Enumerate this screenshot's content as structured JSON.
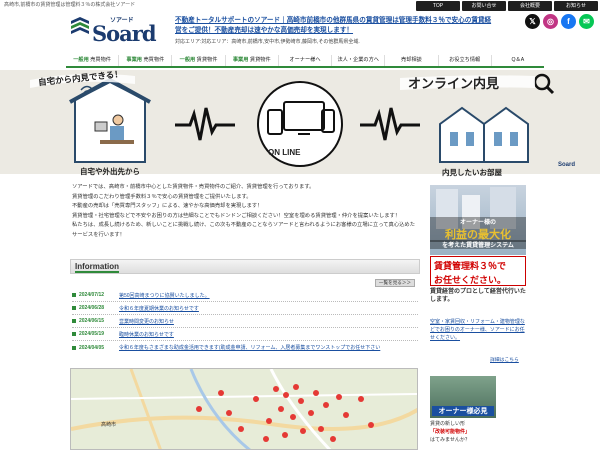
{
  "header": {
    "tagline": "高崎市,前橋市の賃貸管理は管理料３％の株式会社ソアード",
    "top_nav": [
      "TOP",
      "お問い合せ",
      "会社概要",
      "お知らせ"
    ],
    "logo_kana": "ソアード",
    "logo_name": "Soard",
    "headline": "不動産トータルサポートのソアード｜高崎市前橋市の他群馬県の賃貸管理は管理手数料３％で安心の賃貸経営をご提供！不動産売却は速やかな高価売却を実現します！",
    "area_text": "対応エリア:対応エリア：高崎市,前橋市,安中市,伊勢崎市,藤岡市,その他群馬県全域.",
    "social": [
      {
        "name": "x-icon",
        "glyph": "𝕏",
        "color": "#111111"
      },
      {
        "name": "instagram-icon",
        "glyph": "◎",
        "color": "#c13584"
      },
      {
        "name": "facebook-icon",
        "glyph": "f",
        "color": "#1877f2"
      },
      {
        "name": "line-icon",
        "glyph": "✉",
        "color": "#06c755"
      }
    ]
  },
  "main_nav": [
    {
      "prefix": "一般用",
      "label": "売買物件"
    },
    {
      "prefix": "事業用",
      "label": "売買物件"
    },
    {
      "prefix": "一般用",
      "label": "賃貸物件"
    },
    {
      "prefix": "事業用",
      "label": "賃貸物件"
    },
    {
      "prefix": "",
      "label": "オーナー様へ"
    },
    {
      "prefix": "",
      "label": "法人・企業の方へ"
    },
    {
      "prefix": "",
      "label": "売却相談"
    },
    {
      "prefix": "",
      "label": "お役立ち情報"
    },
    {
      "prefix": "",
      "label": "Q＆A"
    }
  ],
  "hero": {
    "left_banner": "自宅から内見できる！",
    "right_banner": "オンライン内見",
    "left_caption": "自宅や外出先から",
    "right_caption": "内見したいお部屋",
    "center_label": "ON LINE",
    "mini_logo": "Soard"
  },
  "intro": [
    "ソアードでは、高崎市・前橋市中心とした賃貸物件・売買物件のご紹介、賃貸管理を行っております。",
    "賃貸管理のこだわり管理手数料３％で安心の賃貸管理をご提供いたします。",
    "不動産の売却は「売買専門スタッフ」による、速やかな高価売却を実現します！",
    "賃貸管理・社宅管理などで不安やお困りの方は些細なことでもドンドンご相談ください！空室を埋める賃貸管理・仲介を提案いたします！",
    "私たちは、成長し続けるため、新しいことに挑戦し続け、この次も不動産のことならソアードと言われるようにお客様の立場に立って真心込めたサービスを行います！"
  ],
  "information": {
    "title": "Information",
    "more": "一覧を見る＞＞",
    "items": [
      {
        "date": "2024/07/12",
        "title": "第50回高崎まつりに協賛いたしました。"
      },
      {
        "date": "2024/06/28",
        "title": "令和６年度夏期休業のお知らせです"
      },
      {
        "date": "2024/06/15",
        "title": "営業時間変更のお知らせ"
      },
      {
        "date": "2024/05/19",
        "title": "臨時休業のお知らせです"
      },
      {
        "date": "2024/04/05",
        "title": "令和６年度もさまざまな助成金活用できます(助成金申請、リフォーム、入居者募集までワンストップでお任せ下さい"
      }
    ]
  },
  "sidebar": {
    "ad1_line1": "オーナー様の",
    "ad1_line2": "利益の最大化",
    "ad1_line3": "を考えた賃貸管理システム",
    "ad2_line1": "賃貸管理料３％で",
    "ad2_line2": "お任せください。",
    "box_title": "賃貸経営のプロとして経営代行いたします。",
    "box_link": "空室・家賃回収・リフォーム・建物管理などでお困りのオーナー様、ソアードにお任せください。",
    "box_more": "詳細はこちら",
    "ad3_label": "オーナー様必見",
    "foot_line1": "賃貸の新しい形",
    "foot_line2": "「改装可能物件」",
    "foot_line3": "はてみませんか？"
  },
  "map": {
    "label": "高崎市"
  }
}
